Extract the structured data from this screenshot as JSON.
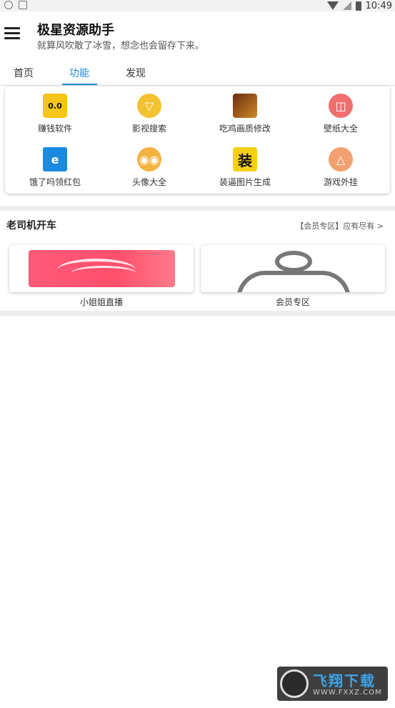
{
  "status_bar": {
    "time": "10:49"
  },
  "app": {
    "title": "极星资源助手",
    "subtitle": "就算风吹散了冰雪，想念也会留存下来。"
  },
  "tabs": [
    {
      "label": "首页",
      "active": false
    },
    {
      "label": "功能",
      "active": true
    },
    {
      "label": "发现",
      "active": false
    }
  ],
  "features": [
    {
      "label": "赚钱软件",
      "icon": "cat-money-icon",
      "glyph": "0.0"
    },
    {
      "label": "影视搜索",
      "icon": "film-search-icon",
      "glyph": "▽"
    },
    {
      "label": "吃鸡画质修改",
      "icon": "game-icon",
      "glyph": ""
    },
    {
      "label": "壁纸大全",
      "icon": "wallpaper-icon",
      "glyph": "◫"
    },
    {
      "label": "饿了吗领红包",
      "icon": "eleme-icon",
      "glyph": "e"
    },
    {
      "label": "头像大全",
      "icon": "avatar-face-icon",
      "glyph": "◉◉"
    },
    {
      "label": "装逼图片生成",
      "icon": "zhuang-icon",
      "glyph": "装"
    },
    {
      "label": "游戏外挂",
      "icon": "triangle-eye-icon",
      "glyph": "△"
    }
  ],
  "section": {
    "title": "老司机开车",
    "more": "【会员专区】应有尽有 >"
  },
  "promos": [
    {
      "label": "小姐姐直播",
      "icon": "live-stream-image"
    },
    {
      "label": "会员专区",
      "icon": "person-icon"
    }
  ],
  "watermark": {
    "text": "飞翔下载",
    "url": "WWW.FXXZ.COM"
  },
  "colors": {
    "accent": "#1c8bd8",
    "divider": "#eeeeee"
  }
}
